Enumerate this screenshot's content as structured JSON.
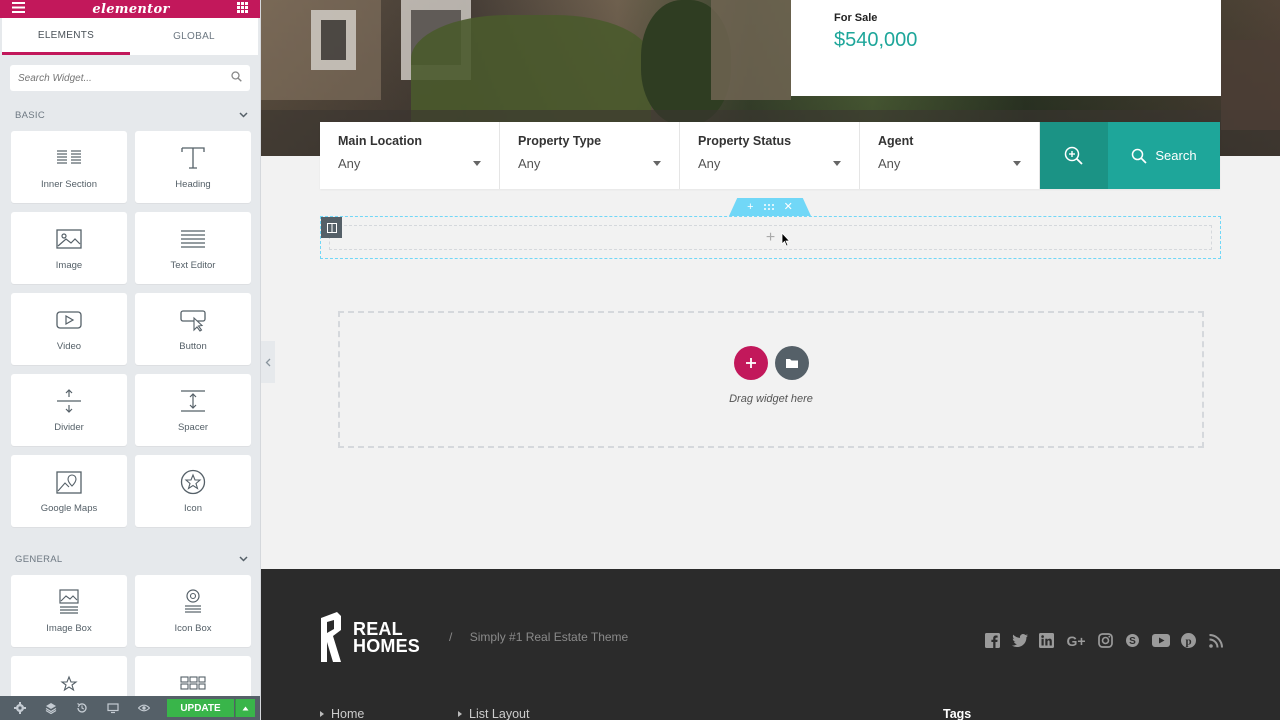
{
  "editor": {
    "logo": "elementor",
    "tabs": [
      {
        "label": "ELEMENTS",
        "active": true
      },
      {
        "label": "GLOBAL",
        "active": false
      }
    ],
    "search_placeholder": "Search Widget...",
    "categories": {
      "basic": {
        "label": "BASIC",
        "widgets": [
          {
            "label": "Inner Section",
            "icon": "inner-section-icon"
          },
          {
            "label": "Heading",
            "icon": "heading-icon"
          },
          {
            "label": "Image",
            "icon": "image-icon"
          },
          {
            "label": "Text Editor",
            "icon": "text-editor-icon"
          },
          {
            "label": "Video",
            "icon": "video-icon"
          },
          {
            "label": "Button",
            "icon": "button-icon"
          },
          {
            "label": "Divider",
            "icon": "divider-icon"
          },
          {
            "label": "Spacer",
            "icon": "spacer-icon"
          },
          {
            "label": "Google Maps",
            "icon": "google-maps-icon"
          },
          {
            "label": "Icon",
            "icon": "star-icon"
          }
        ]
      },
      "general": {
        "label": "GENERAL",
        "widgets": [
          {
            "label": "Image Box",
            "icon": "image-box-icon"
          },
          {
            "label": "Icon Box",
            "icon": "icon-box-icon"
          },
          {
            "label": "",
            "icon": "star-rating-icon"
          },
          {
            "label": "",
            "icon": "gallery-icon"
          }
        ]
      }
    },
    "footer": {
      "update_label": "UPDATE"
    },
    "accent": "#c2185b"
  },
  "preview": {
    "listing": {
      "status": "For Sale",
      "price": "$540,000"
    },
    "search": {
      "fields": [
        {
          "label": "Main Location",
          "value": "Any"
        },
        {
          "label": "Property Type",
          "value": "Any"
        },
        {
          "label": "Property Status",
          "value": "Any"
        },
        {
          "label": "Agent",
          "value": "Any"
        }
      ],
      "button_label": "Search",
      "accent": "#1ea69a"
    },
    "dropzone": {
      "text": "Drag widget here"
    },
    "footer": {
      "brand_line1": "REAL",
      "brand_line2": "HOMES",
      "tagline": "Simply #1 Real Estate Theme",
      "separator": "/",
      "social": [
        "facebook-icon",
        "twitter-icon",
        "linkedin-icon",
        "google-plus-icon",
        "instagram-icon",
        "skype-icon",
        "youtube-icon",
        "pinterest-icon",
        "rss-icon"
      ],
      "links": [
        "Home",
        "List Layout"
      ],
      "tags_heading": "Tags"
    }
  }
}
